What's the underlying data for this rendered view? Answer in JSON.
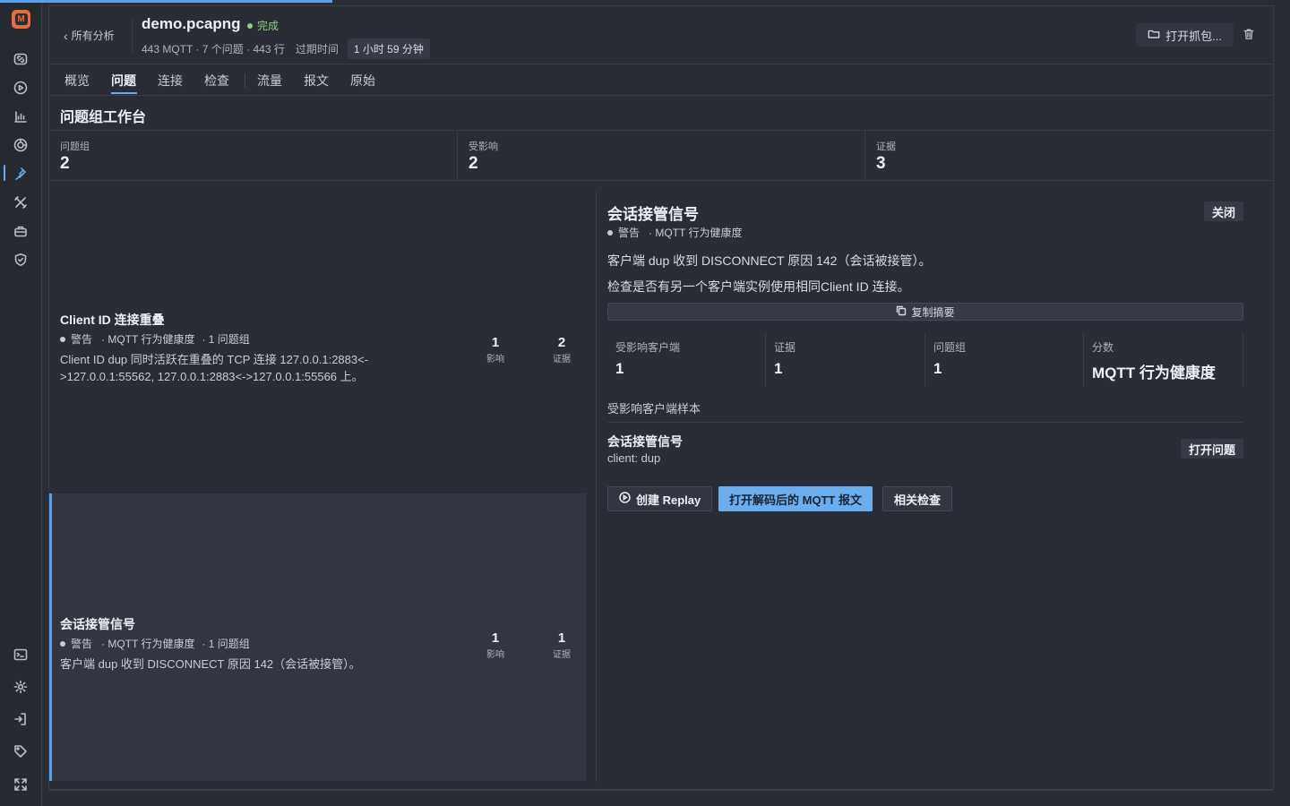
{
  "app": {
    "logo_letter": "M",
    "accent_color": "#6aa8f0",
    "status_color": "#8ed081"
  },
  "rail": {
    "top_icons": [
      "link-icon",
      "play-icon",
      "chart-icon",
      "target-icon",
      "issues-icon",
      "tools-icon",
      "toolbox-icon",
      "shield-icon"
    ],
    "bottom_icons": [
      "terminal-icon",
      "settings-icon",
      "login-icon",
      "tag-icon",
      "expand-icon"
    ],
    "active_icon": "issues-icon"
  },
  "header": {
    "back_label": "所有分析",
    "file_name": "demo.pcapng",
    "status": "完成",
    "meta": "443 MQTT · 7 个问题 · 443 行",
    "elapsed_label": "过期时间",
    "elapsed_value": "1 小时 59 分钟",
    "open_capture_label": "打开抓包..."
  },
  "tabs": [
    {
      "label": "概览",
      "active": false
    },
    {
      "label": "问题",
      "active": true
    },
    {
      "label": "连接",
      "active": false
    },
    {
      "label": "检查",
      "active": false
    },
    {
      "label": "流量",
      "active": false
    },
    {
      "label": "报文",
      "active": false
    },
    {
      "label": "原始",
      "active": false
    }
  ],
  "workbench": {
    "title": "问题组工作台",
    "stats": [
      {
        "label": "问题组",
        "value": "2"
      },
      {
        "label": "受影响",
        "value": "2"
      },
      {
        "label": "证据",
        "value": "3"
      }
    ]
  },
  "issues": [
    {
      "title": "Client ID 连接重叠",
      "severity": "警告",
      "category": "· MQTT 行为健康度",
      "groups": "· 1 问题组",
      "desc_line1": "Client ID dup 同时活跃在重叠的 TCP 连接 127.0.0.1:2883<-",
      "desc_line2": ">127.0.0.1:55562, 127.0.0.1:2883<->127.0.0.1:55566 上。",
      "impact": "1",
      "impact_label": "影响",
      "evidence": "2",
      "evidence_label": "证据",
      "selected": false
    },
    {
      "title": "会话接管信号",
      "severity": "警告",
      "category": "· MQTT 行为健康度",
      "groups": "· 1 问题组",
      "desc_line1": "客户端 dup 收到 DISCONNECT 原因 142（会话被接管）。",
      "desc_line2": "",
      "impact": "1",
      "impact_label": "影响",
      "evidence": "1",
      "evidence_label": "证据",
      "selected": true
    }
  ],
  "detail": {
    "title": "会话接管信号",
    "close_label": "关闭",
    "severity": "警告",
    "category": "· MQTT 行为健康度",
    "summary": "客户端 dup 收到 DISCONNECT 原因 142（会话被接管）。",
    "hint": "检查是否有另一个客户端实例使用相同Client ID 连接。",
    "copy_label": "复制摘要",
    "stats": [
      {
        "label": "受影响客户端",
        "value": "1"
      },
      {
        "label": "证据",
        "value": "1"
      },
      {
        "label": "问题组",
        "value": "1"
      },
      {
        "label": "分数",
        "value": "MQTT 行为健康度"
      }
    ],
    "samples_heading": "受影响客户端样本",
    "sample": {
      "title": "会话接管信号",
      "client": "client: dup",
      "open_label": "打开问题"
    },
    "actions": {
      "replay": "创建 Replay",
      "open_decoded": "打开解码后的 MQTT 报文",
      "related": "相关检查"
    }
  }
}
